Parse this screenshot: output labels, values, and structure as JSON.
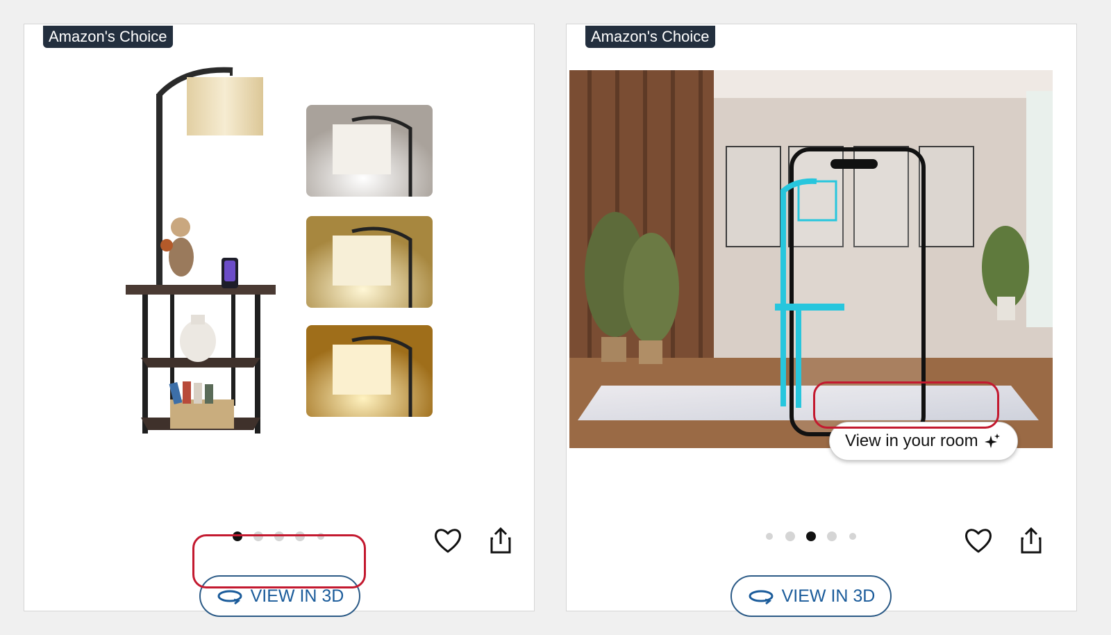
{
  "cards": [
    {
      "badge": "Amazon's Choice",
      "view3d_label": "VIEW IN 3D",
      "dots_active_index": 0
    },
    {
      "badge": "Amazon's Choice",
      "view3d_label": "VIEW IN 3D",
      "room_button_label": "View in your room",
      "dots_active_index": 2
    }
  ],
  "colors": {
    "badge_bg": "#232f3e",
    "link_blue": "#1a5b9a",
    "highlight_red": "#c3192f"
  },
  "icons": [
    "heart-icon",
    "share-icon",
    "rotate-3d-icon",
    "sparkle-icon"
  ]
}
